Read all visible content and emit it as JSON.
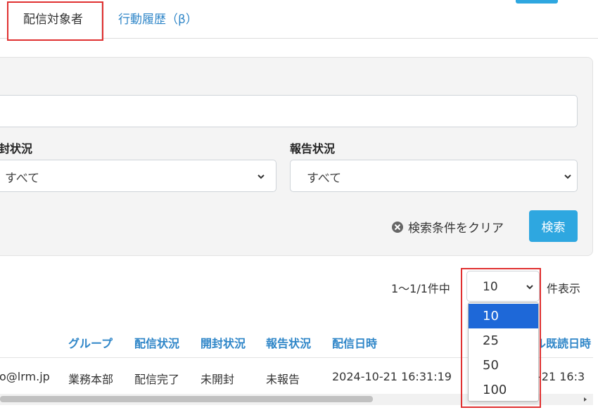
{
  "tabs": [
    {
      "label": "配信対象者",
      "active": true
    },
    {
      "label": "行動履歴（β）",
      "active": false
    }
  ],
  "filters": {
    "open_status_label": "開封状況",
    "open_status_visible_label": "封状況",
    "open_status_value": "すべて",
    "report_status_label": "報告状況",
    "report_status_value": "すべて",
    "clear_label": "検索条件をクリア",
    "search_label": "検索"
  },
  "pagination": {
    "summary": "1〜1/1件中",
    "per_page_value": "10",
    "per_page_suffix": "件表示",
    "options": [
      "10",
      "25",
      "50",
      "100"
    ],
    "selected_option": "10"
  },
  "table": {
    "headers": [
      "グループ",
      "配信状況",
      "開封状況",
      "報告状況",
      "配信日時",
      "ル既読日時"
    ],
    "rows": [
      {
        "email": "o@lrm.jp",
        "group": "業務本部",
        "delivery": "配信完了",
        "open": "未開封",
        "report": "未報告",
        "sent_at": "2024-10-21 16:31:19",
        "read_at": "-21 16:3"
      }
    ]
  },
  "colors": {
    "accent": "#2ea7e0",
    "highlight": "#e03030",
    "link": "#2f86c8",
    "selected": "#1e68d8"
  }
}
